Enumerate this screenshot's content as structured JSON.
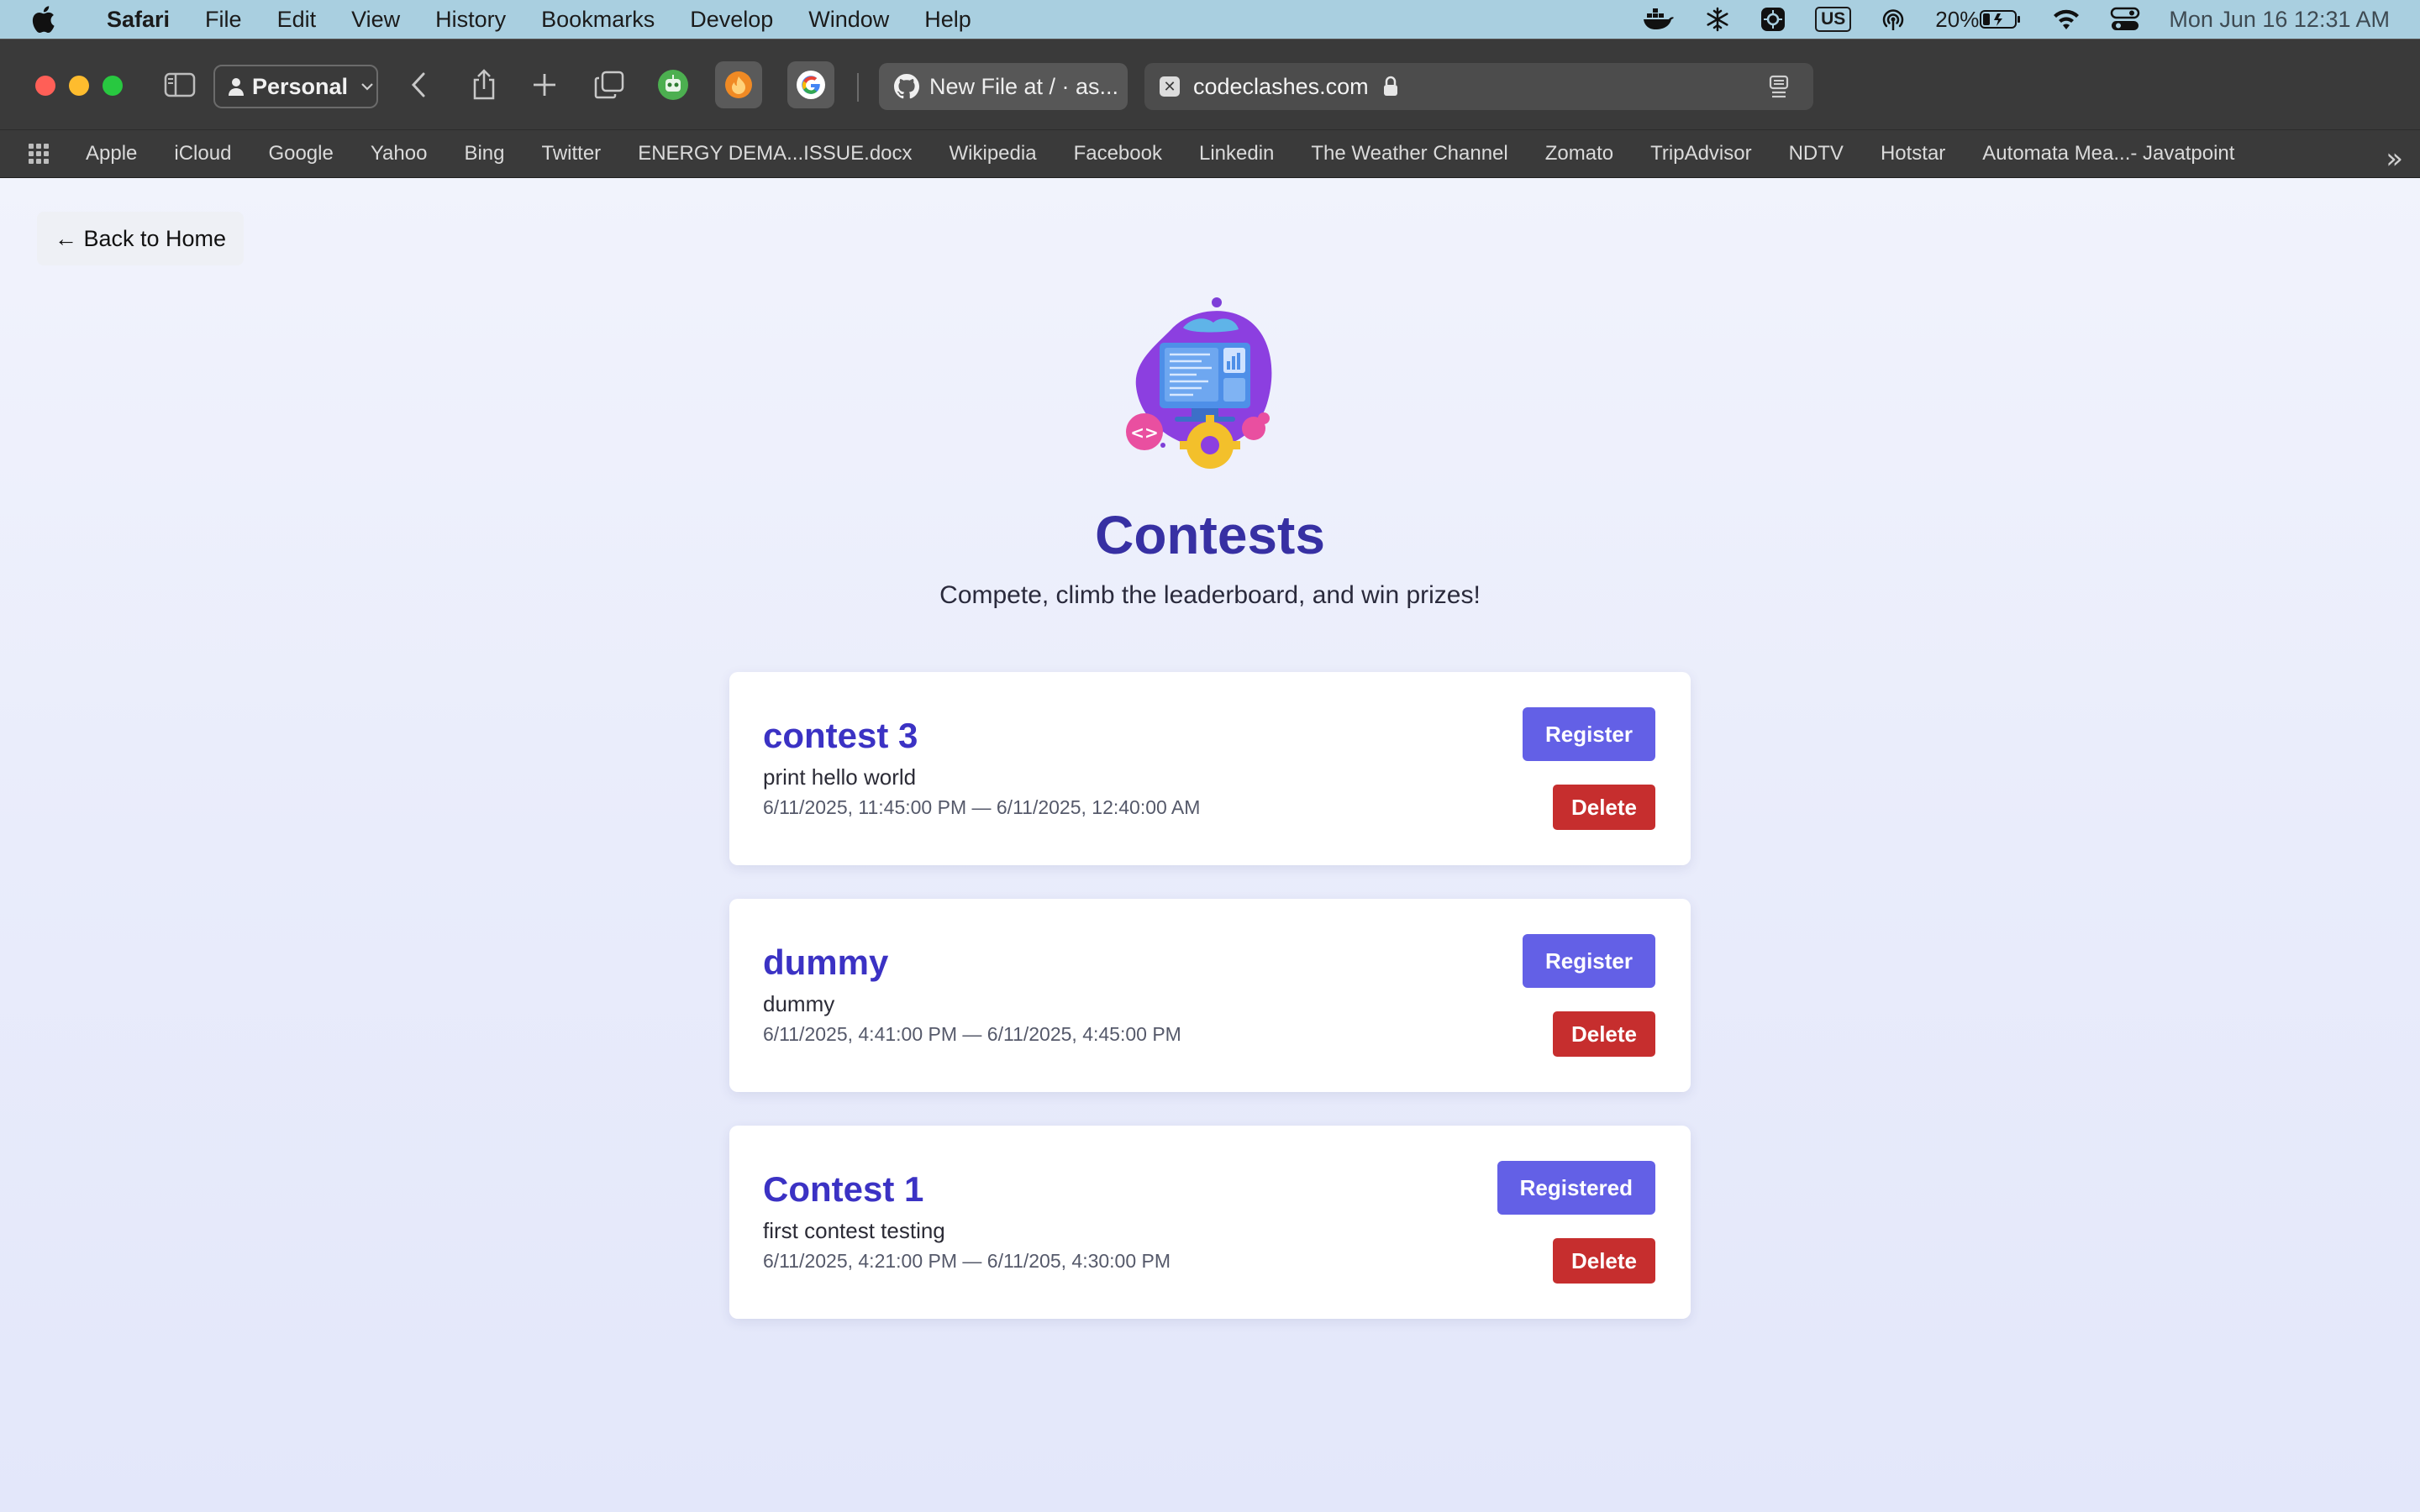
{
  "menubar": {
    "app_name": "Safari",
    "items": [
      "File",
      "Edit",
      "View",
      "History",
      "Bookmarks",
      "Develop",
      "Window",
      "Help"
    ],
    "battery_percent": "20%",
    "keyboard_layout": "US",
    "clock": "Mon Jun 16  12:31 AM"
  },
  "toolbar": {
    "profile_label": "Personal",
    "github_tab_title": "New File at / · as...",
    "address": "codeclashes.com"
  },
  "bookmarks": [
    "Apple",
    "iCloud",
    "Google",
    "Yahoo",
    "Bing",
    "Twitter",
    "ENERGY DEMA...ISSUE.docx",
    "Wikipedia",
    "Facebook",
    "Linkedin",
    "The Weather Channel",
    "Zomato",
    "TripAdvisor",
    "NDTV",
    "Hotstar",
    "Automata Mea...- Javatpoint"
  ],
  "page": {
    "back_label": "← Back to Home",
    "title": "Contests",
    "subtitle": "Compete, climb the leaderboard, and win prizes!",
    "delete_label": "Delete",
    "contests": [
      {
        "title": "contest 3",
        "description": "print hello world",
        "dates": "6/11/2025, 11:45:00 PM — 6/11/2025, 12:40:00 AM",
        "register_label": "Register"
      },
      {
        "title": "dummy",
        "description": "dummy",
        "dates": "6/11/2025, 4:41:00 PM — 6/11/2025, 4:45:00 PM",
        "register_label": "Register"
      },
      {
        "title": "Contest 1",
        "description": "first contest testing",
        "dates": "6/11/2025, 4:21:00 PM — 6/11/205, 4:30:00 PM",
        "register_label": "Registered"
      }
    ]
  },
  "colors": {
    "title": "#3730a3",
    "card_title": "#3b32c4",
    "register": "#6360e6",
    "delete": "#c62e2e"
  }
}
